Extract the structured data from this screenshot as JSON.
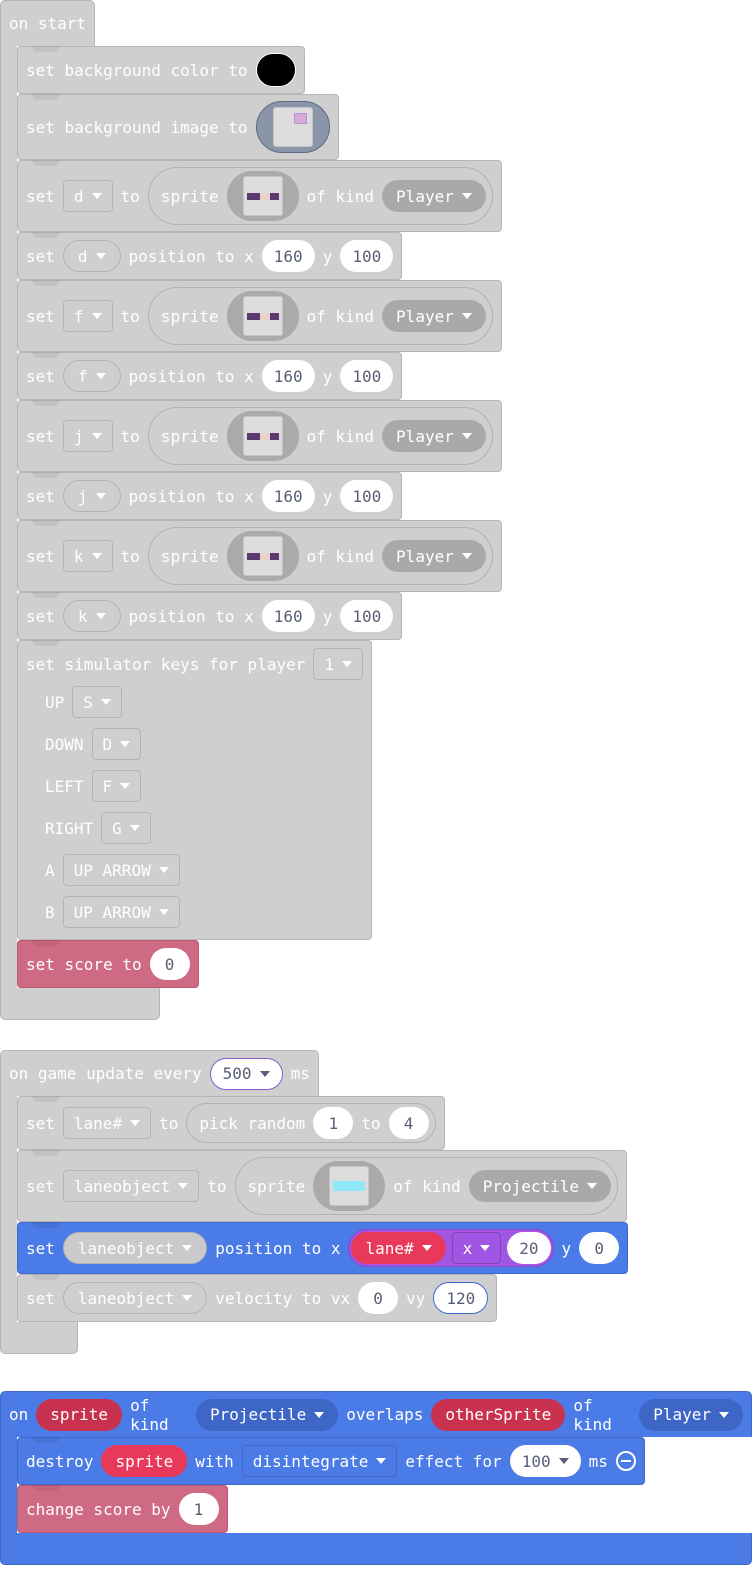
{
  "stacks": [
    {
      "color": "g",
      "hat": [
        {
          "k": "t",
          "v": "on start"
        }
      ],
      "body": [
        {
          "color": "g",
          "lines": [
            [
              {
                "k": "t",
                "v": "set background color to"
              },
              {
                "k": "swatch",
                "color": "#000000"
              }
            ]
          ]
        },
        {
          "color": "g",
          "lines": [
            [
              {
                "k": "t",
                "v": "set background image to"
              },
              {
                "k": "bgimg"
              }
            ]
          ]
        },
        {
          "color": "g",
          "lines": [
            [
              {
                "k": "t",
                "v": "set"
              },
              {
                "k": "dd",
                "v": "d"
              },
              {
                "k": "t",
                "v": "to"
              },
              {
                "k": "rep",
                "items": [
                  {
                    "k": "t",
                    "v": "sprite"
                  },
                  {
                    "k": "spr"
                  },
                  {
                    "k": "t",
                    "v": "of kind"
                  },
                  {
                    "k": "kind",
                    "v": "Player"
                  }
                ]
              }
            ]
          ]
        },
        {
          "color": "g",
          "lines": [
            [
              {
                "k": "t",
                "v": "set"
              },
              {
                "k": "ddr",
                "v": "d"
              },
              {
                "k": "t",
                "v": "position to x"
              },
              {
                "k": "num",
                "v": "160"
              },
              {
                "k": "t",
                "v": "y"
              },
              {
                "k": "num",
                "v": "100"
              }
            ]
          ]
        },
        {
          "color": "g",
          "lines": [
            [
              {
                "k": "t",
                "v": "set"
              },
              {
                "k": "dd",
                "v": "f"
              },
              {
                "k": "t",
                "v": "to"
              },
              {
                "k": "rep",
                "items": [
                  {
                    "k": "t",
                    "v": "sprite"
                  },
                  {
                    "k": "spr"
                  },
                  {
                    "k": "t",
                    "v": "of kind"
                  },
                  {
                    "k": "kind",
                    "v": "Player"
                  }
                ]
              }
            ]
          ]
        },
        {
          "color": "g",
          "lines": [
            [
              {
                "k": "t",
                "v": "set"
              },
              {
                "k": "ddr",
                "v": "f"
              },
              {
                "k": "t",
                "v": "position to x"
              },
              {
                "k": "num",
                "v": "160"
              },
              {
                "k": "t",
                "v": "y"
              },
              {
                "k": "num",
                "v": "100"
              }
            ]
          ]
        },
        {
          "color": "g",
          "lines": [
            [
              {
                "k": "t",
                "v": "set"
              },
              {
                "k": "dd",
                "v": "j"
              },
              {
                "k": "t",
                "v": "to"
              },
              {
                "k": "rep",
                "items": [
                  {
                    "k": "t",
                    "v": "sprite"
                  },
                  {
                    "k": "spr"
                  },
                  {
                    "k": "t",
                    "v": "of kind"
                  },
                  {
                    "k": "kind",
                    "v": "Player"
                  }
                ]
              }
            ]
          ]
        },
        {
          "color": "g",
          "lines": [
            [
              {
                "k": "t",
                "v": "set"
              },
              {
                "k": "ddr",
                "v": "j"
              },
              {
                "k": "t",
                "v": "position to x"
              },
              {
                "k": "num",
                "v": "160"
              },
              {
                "k": "t",
                "v": "y"
              },
              {
                "k": "num",
                "v": "100"
              }
            ]
          ]
        },
        {
          "color": "g",
          "lines": [
            [
              {
                "k": "t",
                "v": "set"
              },
              {
                "k": "dd",
                "v": "k"
              },
              {
                "k": "t",
                "v": "to"
              },
              {
                "k": "rep",
                "items": [
                  {
                    "k": "t",
                    "v": "sprite"
                  },
                  {
                    "k": "spr"
                  },
                  {
                    "k": "t",
                    "v": "of kind"
                  },
                  {
                    "k": "kind",
                    "v": "Player"
                  }
                ]
              }
            ]
          ]
        },
        {
          "color": "g",
          "lines": [
            [
              {
                "k": "t",
                "v": "set"
              },
              {
                "k": "ddr",
                "v": "k"
              },
              {
                "k": "t",
                "v": "position to x"
              },
              {
                "k": "num",
                "v": "160"
              },
              {
                "k": "t",
                "v": "y"
              },
              {
                "k": "num",
                "v": "100"
              }
            ]
          ]
        },
        {
          "color": "g",
          "lines": [
            [
              {
                "k": "t",
                "v": "set simulator keys for player"
              },
              {
                "k": "dd",
                "v": "1"
              }
            ],
            [
              {
                "k": "t",
                "v": "UP"
              },
              {
                "k": "dd",
                "v": "S"
              }
            ],
            [
              {
                "k": "t",
                "v": "DOWN"
              },
              {
                "k": "dd",
                "v": "D"
              }
            ],
            [
              {
                "k": "t",
                "v": "LEFT"
              },
              {
                "k": "dd",
                "v": "F"
              }
            ],
            [
              {
                "k": "t",
                "v": "RIGHT"
              },
              {
                "k": "dd",
                "v": "G"
              }
            ],
            [
              {
                "k": "t",
                "v": "A"
              },
              {
                "k": "dd",
                "v": "UP ARROW"
              }
            ],
            [
              {
                "k": "t",
                "v": "B"
              },
              {
                "k": "dd",
                "v": "UP ARROW"
              }
            ]
          ]
        },
        {
          "color": "p",
          "lines": [
            [
              {
                "k": "t",
                "v": "set score to"
              },
              {
                "k": "num",
                "v": "0"
              }
            ]
          ]
        }
      ]
    },
    {
      "color": "g",
      "hat": [
        {
          "k": "t",
          "v": "on game update every"
        },
        {
          "k": "numdd",
          "v": "500",
          "style": "pb"
        },
        {
          "k": "t",
          "v": "ms"
        }
      ],
      "body": [
        {
          "color": "g",
          "lines": [
            [
              {
                "k": "t",
                "v": "set"
              },
              {
                "k": "dd",
                "v": "lane#"
              },
              {
                "k": "t",
                "v": "to"
              },
              {
                "k": "rep",
                "items": [
                  {
                    "k": "t",
                    "v": "pick random"
                  },
                  {
                    "k": "num",
                    "v": "1"
                  },
                  {
                    "k": "t",
                    "v": "to"
                  },
                  {
                    "k": "num",
                    "v": "4"
                  }
                ]
              }
            ]
          ]
        },
        {
          "color": "g",
          "lines": [
            [
              {
                "k": "t",
                "v": "set"
              },
              {
                "k": "dd",
                "v": "laneobject"
              },
              {
                "k": "t",
                "v": "to"
              },
              {
                "k": "rep",
                "items": [
                  {
                    "k": "t",
                    "v": "sprite"
                  },
                  {
                    "k": "sprcyan"
                  },
                  {
                    "k": "t",
                    "v": "of kind"
                  },
                  {
                    "k": "kind",
                    "v": "Projectile"
                  }
                ]
              }
            ]
          ]
        },
        {
          "color": "b",
          "lines": [
            [
              {
                "k": "t",
                "v": "set"
              },
              {
                "k": "varg",
                "v": "laneobject"
              },
              {
                "k": "t",
                "v": "position to x"
              },
              {
                "k": "purple",
                "items": [
                  {
                    "k": "red",
                    "v": "lane#"
                  },
                  {
                    "k": "dd",
                    "v": "x"
                  },
                  {
                    "k": "num",
                    "v": "20"
                  }
                ]
              },
              {
                "k": "t",
                "v": "y"
              },
              {
                "k": "num",
                "v": "0"
              }
            ]
          ]
        },
        {
          "color": "g",
          "lines": [
            [
              {
                "k": "t",
                "v": "set"
              },
              {
                "k": "ddr",
                "v": "laneobject"
              },
              {
                "k": "t",
                "v": "velocity to vx"
              },
              {
                "k": "num",
                "v": "0"
              },
              {
                "k": "t",
                "v": "vy"
              },
              {
                "k": "num",
                "v": "120",
                "style": "bb"
              }
            ]
          ]
        }
      ]
    },
    {
      "color": "b",
      "hat": [
        {
          "k": "t",
          "v": "on"
        },
        {
          "k": "redd",
          "v": "sprite"
        },
        {
          "k": "t",
          "v": "of kind"
        },
        {
          "k": "kind",
          "v": "Projectile"
        },
        {
          "k": "t",
          "v": "overlaps"
        },
        {
          "k": "redd",
          "v": "otherSprite"
        },
        {
          "k": "t",
          "v": "of kind"
        },
        {
          "k": "kind",
          "v": "Player"
        }
      ],
      "body": [
        {
          "color": "b",
          "lines": [
            [
              {
                "k": "t",
                "v": "destroy"
              },
              {
                "k": "red",
                "v": "sprite"
              },
              {
                "k": "t",
                "v": "with"
              },
              {
                "k": "dd",
                "v": "disintegrate"
              },
              {
                "k": "t",
                "v": "effect for"
              },
              {
                "k": "numdd",
                "v": "100"
              },
              {
                "k": "t",
                "v": "ms"
              },
              {
                "k": "minus"
              }
            ]
          ]
        },
        {
          "color": "p",
          "lines": [
            [
              {
                "k": "t",
                "v": "change score by"
              },
              {
                "k": "num",
                "v": "1"
              }
            ]
          ]
        }
      ]
    }
  ]
}
